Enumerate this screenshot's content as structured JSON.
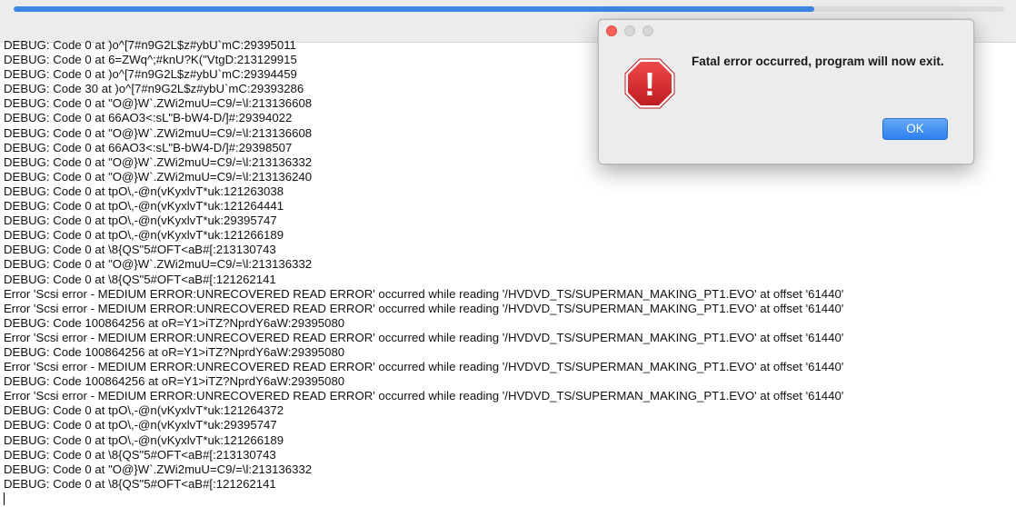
{
  "progress": {
    "fraction": 0.808
  },
  "log_lines": [
    "DEBUG: Code 0 at )o^[7#n9G2L$z#ybU`mC:29395011",
    "DEBUG: Code 0 at 6=ZWq^;#knU?K(\"VtgD:213129915",
    "DEBUG: Code 0 at )o^[7#n9G2L$z#ybU`mC:29394459",
    "DEBUG: Code 30 at )o^[7#n9G2L$z#ybU`mC:29393286",
    "DEBUG: Code 0 at \"O@}W`.ZWi2muU=C9/=\\l:213136608",
    "DEBUG: Code 0 at 66AO3<:sL\"B-bW4-D/]#:29394022",
    "DEBUG: Code 0 at \"O@}W`.ZWi2muU=C9/=\\l:213136608",
    "DEBUG: Code 0 at 66AO3<:sL\"B-bW4-D/]#:29398507",
    "DEBUG: Code 0 at \"O@}W`.ZWi2muU=C9/=\\l:213136332",
    "DEBUG: Code 0 at \"O@}W`.ZWi2muU=C9/=\\l:213136240",
    "DEBUG: Code 0 at tpO\\,-@n(vKyxlvT*uk:121263038",
    "DEBUG: Code 0 at tpO\\,-@n(vKyxlvT*uk:121264441",
    "DEBUG: Code 0 at tpO\\,-@n(vKyxlvT*uk:29395747",
    "DEBUG: Code 0 at tpO\\,-@n(vKyxlvT*uk:121266189",
    "DEBUG: Code 0 at \\8{QS\"5#OFT<aB#[:213130743",
    "DEBUG: Code 0 at \"O@}W`.ZWi2muU=C9/=\\l:213136332",
    "DEBUG: Code 0 at \\8{QS\"5#OFT<aB#[:121262141",
    "Error 'Scsi error - MEDIUM ERROR:UNRECOVERED READ ERROR' occurred while reading '/HVDVD_TS/SUPERMAN_MAKING_PT1.EVO' at offset '61440'",
    "Error 'Scsi error - MEDIUM ERROR:UNRECOVERED READ ERROR' occurred while reading '/HVDVD_TS/SUPERMAN_MAKING_PT1.EVO' at offset '61440'",
    "DEBUG: Code 100864256 at oR=Y1>iTZ?NprdY6aW:29395080",
    "Error 'Scsi error - MEDIUM ERROR:UNRECOVERED READ ERROR' occurred while reading '/HVDVD_TS/SUPERMAN_MAKING_PT1.EVO' at offset '61440'",
    "DEBUG: Code 100864256 at oR=Y1>iTZ?NprdY6aW:29395080",
    "Error 'Scsi error - MEDIUM ERROR:UNRECOVERED READ ERROR' occurred while reading '/HVDVD_TS/SUPERMAN_MAKING_PT1.EVO' at offset '61440'",
    "DEBUG: Code 100864256 at oR=Y1>iTZ?NprdY6aW:29395080",
    "Error 'Scsi error - MEDIUM ERROR:UNRECOVERED READ ERROR' occurred while reading '/HVDVD_TS/SUPERMAN_MAKING_PT1.EVO' at offset '61440'",
    "DEBUG: Code 0 at tpO\\,-@n(vKyxlvT*uk:121264372",
    "DEBUG: Code 0 at tpO\\,-@n(vKyxlvT*uk:29395747",
    "DEBUG: Code 0 at tpO\\,-@n(vKyxlvT*uk:121266189",
    "DEBUG: Code 0 at \\8{QS\"5#OFT<aB#[:213130743",
    "DEBUG: Code 0 at \"O@}W`.ZWi2muU=C9/=\\l:213136332",
    "DEBUG: Code 0 at \\8{QS\"5#OFT<aB#[:121262141"
  ],
  "dialog": {
    "message": "Fatal error occurred, program will now exit.",
    "ok_label": "OK",
    "icon": "stop-alert-icon",
    "icon_symbol": "!"
  },
  "colors": {
    "progress_fill": "#3d86e4",
    "stop_red": "#d8262b",
    "ok_blue": "#2b7ff0"
  }
}
